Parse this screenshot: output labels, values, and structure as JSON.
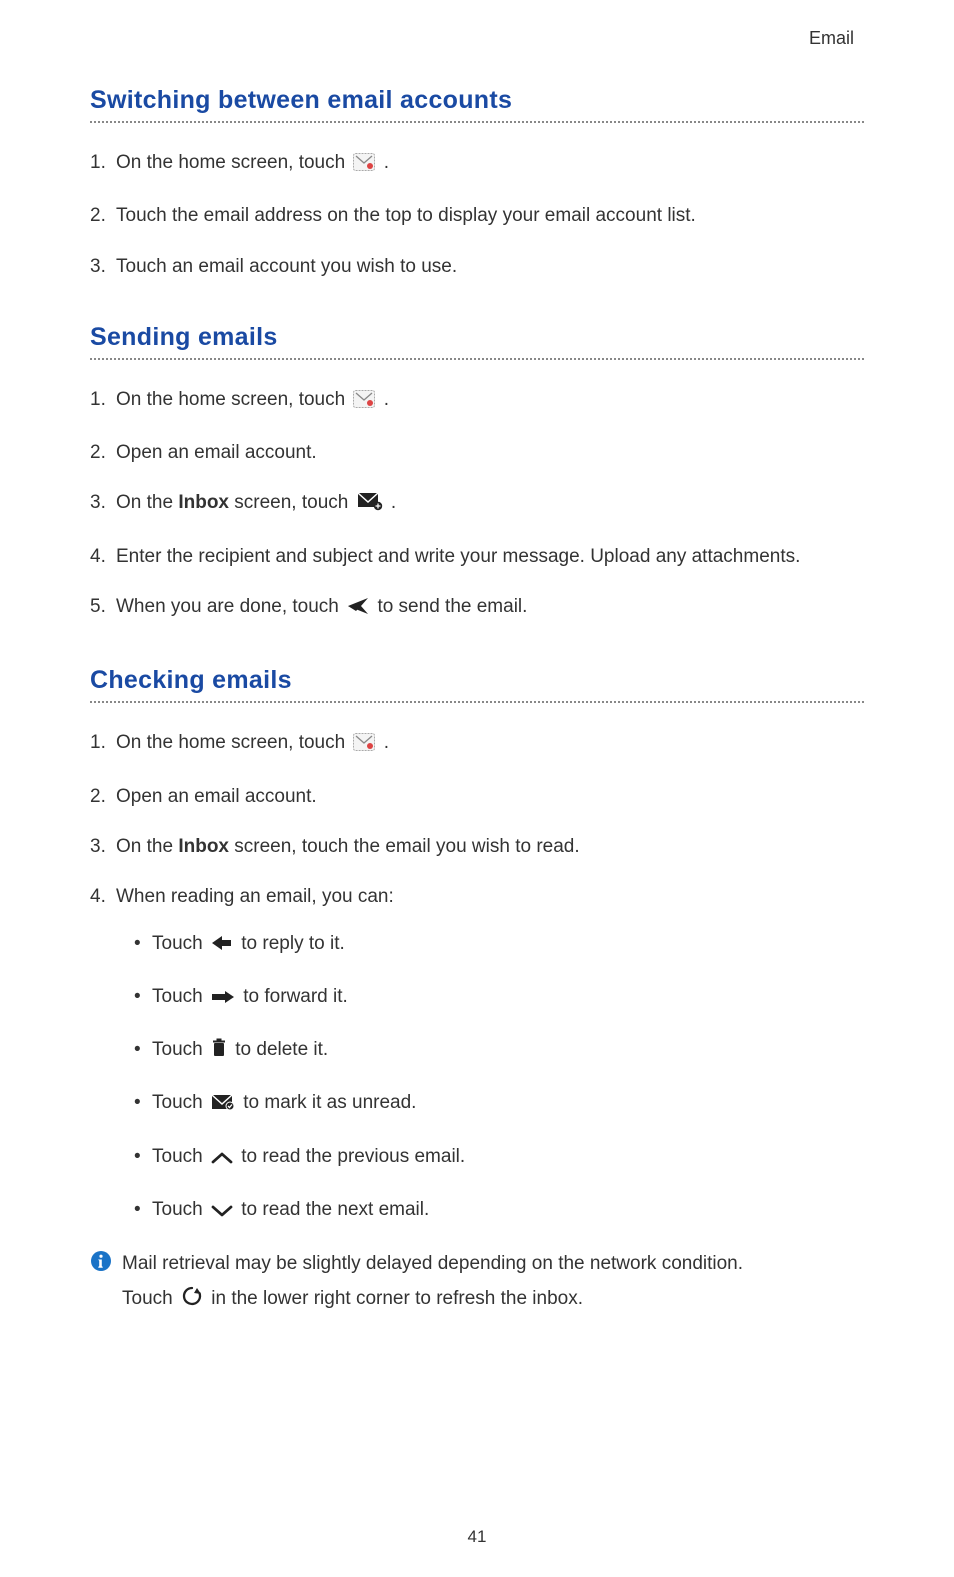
{
  "header": {
    "category": "Email"
  },
  "sections": {
    "switch": {
      "title": "Switching between email accounts",
      "steps": {
        "s1a": "On the home screen, touch ",
        "s1b": ".",
        "s2": "Touch the email address on the top to display your email account list.",
        "s3": "Touch an email account you wish to use."
      }
    },
    "send": {
      "title": "Sending emails",
      "steps": {
        "s1a": "On the home screen, touch ",
        "s1b": ".",
        "s2": "Open an email account.",
        "s3a": "On the ",
        "s3bold": "Inbox",
        "s3b": " screen, touch ",
        "s3c": ".",
        "s4": "Enter the recipient and subject and write your message. Upload any attachments.",
        "s5a": "When you are done, touch ",
        "s5b": " to send the email."
      }
    },
    "check": {
      "title": "Checking emails",
      "steps": {
        "s1a": "On the home screen, touch ",
        "s1b": ".",
        "s2": "Open an email account.",
        "s3a": "On the ",
        "s3bold": "Inbox",
        "s3b": " screen, touch the email you wish to read.",
        "s4": "When reading an email, you can:"
      },
      "sub": {
        "b1a": "Touch ",
        "b1b": " to reply to it.",
        "b2a": "Touch ",
        "b2b": "to forward it.",
        "b3a": "Touch ",
        "b3b": " to delete it.",
        "b4a": "Touch ",
        "b4b": " to mark it as unread.",
        "b5a": "Touch ",
        "b5b": " to read the previous email.",
        "b6a": "Touch ",
        "b6b": " to read the next email."
      },
      "note": {
        "line1": "Mail retrieval may be slightly delayed depending on the network condition. ",
        "line2a": "Touch ",
        "line2b": " in the lower right corner to refresh the inbox."
      }
    }
  },
  "page_number": "41"
}
